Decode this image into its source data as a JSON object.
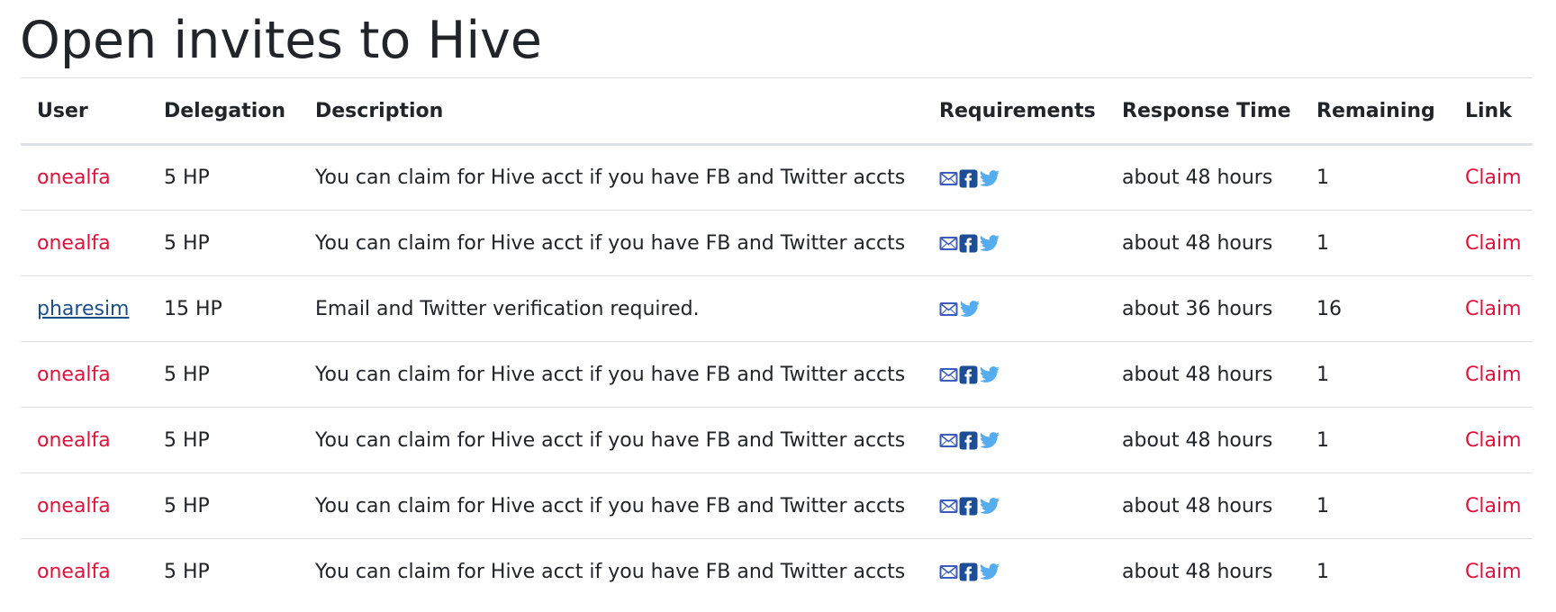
{
  "page": {
    "title": "Open invites to Hive"
  },
  "colors": {
    "link_primary": "#dc143c",
    "link_default": "#1c4f8a",
    "email_icon": "#3b5bbd",
    "facebook_icon": "#1d4d96",
    "twitter_icon": "#55acee"
  },
  "table": {
    "headers": {
      "user": "User",
      "delegation": "Delegation",
      "description": "Description",
      "requirements": "Requirements",
      "response_time": "Response Time",
      "remaining": "Remaining",
      "link": "Link"
    },
    "rows": [
      {
        "user": "onealfa",
        "user_style": "primary",
        "delegation": "5 HP",
        "description": "You can claim for Hive acct if you have FB and Twitter accts",
        "requirements": [
          "email-icon",
          "facebook-icon",
          "twitter-icon"
        ],
        "response_time": "about 48 hours",
        "remaining": "1",
        "link": "Claim"
      },
      {
        "user": "onealfa",
        "user_style": "primary",
        "delegation": "5 HP",
        "description": "You can claim for Hive acct if you have FB and Twitter accts",
        "requirements": [
          "email-icon",
          "facebook-icon",
          "twitter-icon"
        ],
        "response_time": "about 48 hours",
        "remaining": "1",
        "link": "Claim"
      },
      {
        "user": "pharesim",
        "user_style": "default",
        "delegation": "15 HP",
        "description": "Email and Twitter verification required.",
        "requirements": [
          "email-icon",
          "twitter-icon"
        ],
        "response_time": "about 36 hours",
        "remaining": "16",
        "link": "Claim"
      },
      {
        "user": "onealfa",
        "user_style": "primary",
        "delegation": "5 HP",
        "description": "You can claim for Hive acct if you have FB and Twitter accts",
        "requirements": [
          "email-icon",
          "facebook-icon",
          "twitter-icon"
        ],
        "response_time": "about 48 hours",
        "remaining": "1",
        "link": "Claim"
      },
      {
        "user": "onealfa",
        "user_style": "primary",
        "delegation": "5 HP",
        "description": "You can claim for Hive acct if you have FB and Twitter accts",
        "requirements": [
          "email-icon",
          "facebook-icon",
          "twitter-icon"
        ],
        "response_time": "about 48 hours",
        "remaining": "1",
        "link": "Claim"
      },
      {
        "user": "onealfa",
        "user_style": "primary",
        "delegation": "5 HP",
        "description": "You can claim for Hive acct if you have FB and Twitter accts",
        "requirements": [
          "email-icon",
          "facebook-icon",
          "twitter-icon"
        ],
        "response_time": "about 48 hours",
        "remaining": "1",
        "link": "Claim"
      },
      {
        "user": "onealfa",
        "user_style": "primary",
        "delegation": "5 HP",
        "description": "You can claim for Hive acct if you have FB and Twitter accts",
        "requirements": [
          "email-icon",
          "facebook-icon",
          "twitter-icon"
        ],
        "response_time": "about 48 hours",
        "remaining": "1",
        "link": "Claim"
      }
    ]
  }
}
